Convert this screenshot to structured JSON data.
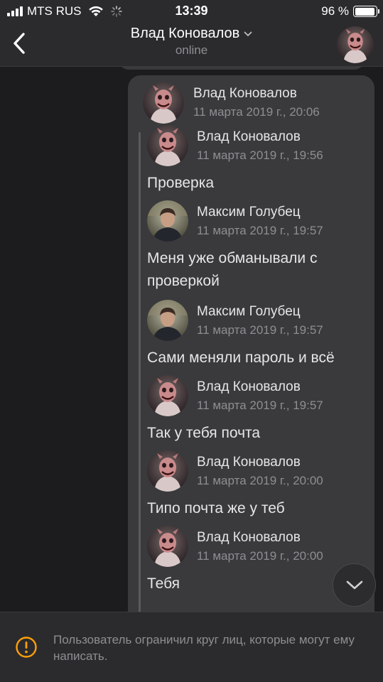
{
  "status_bar": {
    "carrier": "MTS RUS",
    "time": "13:39",
    "battery_text": "96 %",
    "battery_level": 0.96
  },
  "header": {
    "title": "Влад Коновалов",
    "subtitle": "online",
    "back_icon": "chevron-left-icon",
    "title_dropdown_icon": "chevron-down-icon"
  },
  "forward": {
    "author": "Влад Коновалов",
    "date": "11 марта 2019 г., 20:06",
    "messages": [
      {
        "author": "Влад Коновалов",
        "date": "11 марта 2019 г., 19:56",
        "text": "Проверка",
        "avatar": "vlad"
      },
      {
        "author": "Максим Голубец",
        "date": "11 марта 2019 г., 19:57",
        "text": "Меня уже обманывали с проверкой",
        "avatar": "maxim"
      },
      {
        "author": "Максим Голубец",
        "date": "11 марта 2019 г., 19:57",
        "text": "Сами меняли пароль и всё",
        "avatar": "maxim"
      },
      {
        "author": "Влад Коновалов",
        "date": "11 марта 2019 г., 19:57",
        "text": "Так у тебя почта",
        "avatar": "vlad"
      },
      {
        "author": "Влад Коновалов",
        "date": "11 марта 2019 г., 20:00",
        "text": "Типо почта же у теб",
        "avatar": "vlad"
      },
      {
        "author": "Влад Коновалов",
        "date": "11 марта 2019 г., 20:00",
        "text": "Тебя",
        "avatar": "vlad"
      }
    ]
  },
  "restriction_notice": {
    "text": "Пользователь ограничил круг лиц, которые могут ему написать.",
    "icon": "alert-circle-icon"
  },
  "colors": {
    "background": "#1c1c1e",
    "bubble": "#3a3a3c",
    "bar": "#2b2b2d",
    "secondary_text": "#8e8e93",
    "warning": "#ff9f0a"
  }
}
